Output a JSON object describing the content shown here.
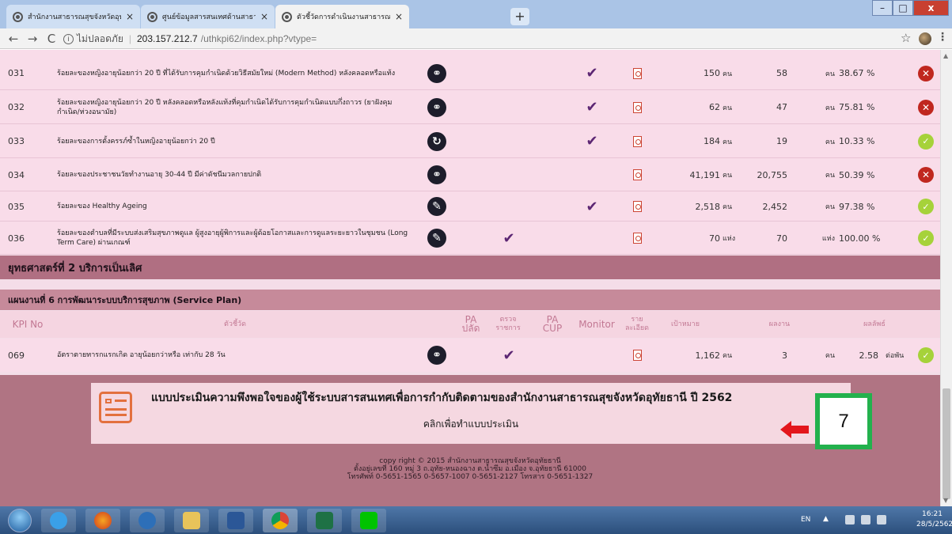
{
  "browser": {
    "tabs": [
      {
        "title": "สำนักงานสาธารณสุขจังหวัดอุทัยธานี"
      },
      {
        "title": "ศูนย์ข้อมูลสารสนเทศด้านสาธารณสุข"
      },
      {
        "title": "ตัวชี้วัดการดำเนินงานสาธารณสุข สำนัก"
      }
    ],
    "new_tab_label": "+",
    "close_label": "×",
    "window_controls": {
      "minimize": "–",
      "maximize": "□",
      "close": "x"
    },
    "nav": {
      "back": "←",
      "forward": "→",
      "reload": "C"
    },
    "address": {
      "security": "ไม่ปลอดภัย",
      "host": "203.157.212.7",
      "path": "/uthkpi62/index.php?vtype="
    }
  },
  "kpi_rows": [
    {
      "no": "031",
      "name": "ร้อยละของหญิงอายุน้อยกว่า 20 ปี ที่ได้รับการคุมกำเนิดด้วยวิธีสมัยใหม่ (Modern Method) หลังคลอดหรือแท้ง",
      "action_icon": "link-icon",
      "pa": "",
      "monitor": "✔",
      "target": "150",
      "target_unit": "คน",
      "result": "58",
      "result_unit": "คน",
      "percent": "38.67 %",
      "status": "fail"
    },
    {
      "no": "032",
      "name": "ร้อยละของหญิงอายุน้อยกว่า 20 ปี หลังคลอดหรือหลังแท้งที่คุมกำเนิดได้รับการคุมกำเนิดแบบกึ่งถาวร (ยาฝังคุมกำเนิด/ห่วงอนามัย)",
      "action_icon": "link-icon",
      "pa": "",
      "monitor": "✔",
      "target": "62",
      "target_unit": "คน",
      "result": "47",
      "result_unit": "คน",
      "percent": "75.81 %",
      "status": "fail"
    },
    {
      "no": "033",
      "name": "ร้อยละของการตั้งครรภ์ซ้ำในหญิงอายุน้อยกว่า 20 ปี",
      "action_icon": "refresh-icon",
      "pa": "",
      "monitor": "✔",
      "target": "184",
      "target_unit": "คน",
      "result": "19",
      "result_unit": "คน",
      "percent": "10.33 %",
      "status": "pass"
    },
    {
      "no": "034",
      "name": "ร้อยละของประชาชนวัยทำงานอายุ 30-44 ปี มีค่าดัชนีมวลกายปกติ",
      "action_icon": "link-icon",
      "pa": "",
      "monitor": "",
      "target": "41,191",
      "target_unit": "คน",
      "result": "20,755",
      "result_unit": "คน",
      "percent": "50.39 %",
      "status": "fail"
    },
    {
      "no": "035",
      "name": "ร้อยละของ Healthy Ageing",
      "action_icon": "pencil-icon",
      "pa": "",
      "monitor": "✔",
      "target": "2,518",
      "target_unit": "คน",
      "result": "2,452",
      "result_unit": "คน",
      "percent": "97.38 %",
      "status": "pass"
    },
    {
      "no": "036",
      "name": "ร้อยละของตำบลที่มีระบบส่งเสริมสุขภาพดูแล ผู้สูงอายุผู้พิการและผู้ด้อยโอกาสและการดูแลระยะยาวในชุมชน (Long Term Care) ผ่านเกณฑ์",
      "action_icon": "pencil-icon",
      "pa": "✔",
      "monitor": "",
      "target": "70",
      "target_unit": "แห่ง",
      "result": "70",
      "result_unit": "แห่ง",
      "percent": "100.00 %",
      "status": "pass"
    }
  ],
  "strategy_title": "ยุทธศาสตร์ที่ 2 บริการเป็นเลิศ",
  "plan_title": "แผนงานที่ 6 การพัฒนาระบบบริการสุขภาพ (Service Plan)",
  "table_headers": {
    "kpi_no": "KPI No",
    "indicator": "ตัวชี้วัด",
    "pa_ministry": "PA ปลัด",
    "inspection": "ตรวจ ราชการ",
    "pa_cup": "PA CUP",
    "monitor": "Monitor",
    "detail": "ราย ละเอียด",
    "target": "เป้าหมาย",
    "result": "ผลงาน",
    "outcome": "ผลลัพธ์"
  },
  "plan_row": {
    "no": "069",
    "name": "อัตราตายทารกแรกเกิด อายุน้อยกว่าหรือ เท่ากับ 28 วัน",
    "action_icon": "link-icon",
    "pa": "",
    "inspection": "✔",
    "target": "1,162",
    "target_unit": "คน",
    "result": "3",
    "result_unit": "คน",
    "percent": "2.58",
    "percent_unit": "ต่อพัน",
    "status": "pass"
  },
  "survey": {
    "title": "แบบประเมินความพึงพอใจของผู้ใช้ระบบสารสนเทศเพื่อการกำกับติดตามของสำนักงานสาธารณสุขจังหวัดอุทัยธานี ปี 2562",
    "link_text": "คลิกเพื่อทำแบบประเมิน",
    "annotation_number": "7"
  },
  "copyright": {
    "line1": "copy right © 2015 สำนักงานสาธารณสุขจังหวัดอุทัยธานี",
    "line2": "ตั้งอยู่เลขที่ 160 หมู่ 3 ถ.อุทัย-หนองฉาง ต.น้ำซึม อ.เมือง จ.อุทัยธานี 61000",
    "line3": "โทรศัพท์ 0-5651-1565 0-5657-1007 0-5651-2127 โทรสาร 0-5651-1327"
  },
  "taskbar": {
    "lang": "EN",
    "tray_arrow": "▲",
    "time": "16:21",
    "date": "28/5/2562"
  },
  "colors": {
    "status_fail": "#c0271f",
    "status_pass": "#a6d23a",
    "check": "#5c2673",
    "strategy_band": "#b06f82",
    "footer": "#b07483",
    "annotation_border": "#23b14d"
  }
}
